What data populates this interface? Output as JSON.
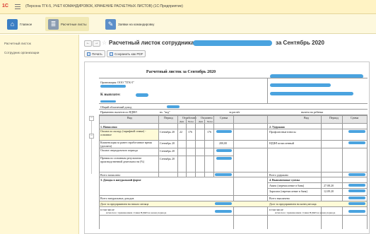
{
  "app": {
    "logo": "1С",
    "title": "(Персона ТГК-5, УЧЕТ КОМАНДИРОВОК, КРАЧЕНИЕ РАСЧЕТНЫХ ЛИСТОВ) (1С:Предприятие)"
  },
  "toolbar": {
    "items": [
      {
        "label": "Главное"
      },
      {
        "label": "Расчетные листы"
      },
      {
        "label": "Заявки на командировку"
      }
    ]
  },
  "sidebar": {
    "items": [
      {
        "label": "Расчетный листок"
      },
      {
        "label": "Сотрудник организации"
      }
    ]
  },
  "header": {
    "title": "Расчетный листок сотрудника",
    "period": "за Сентябрь 2020"
  },
  "actions": {
    "print": "Печать",
    "save_pdf": "Сохранить как PDF"
  },
  "document": {
    "heading": "Расчетный листок за Сентябрь 2020",
    "org_label": "Организация: ООО \"ТГК-5\"",
    "payout_label": "К выплате:",
    "total_worked": "Общий облагаемый доход",
    "tax_rate": "Применено вычетов по НДФЛ",
    "code_label": "вх. \"код\"",
    "period_label": "за расчёт",
    "tax_deduction": "вычета на ребенка",
    "col_type": "Вид",
    "col_period": "Период",
    "col_worked": "Отработано",
    "col_paid": "Оплачено",
    "col_days": "Дни",
    "col_hours": "Часы",
    "col_sum": "Сумма",
    "section1": "1. Начислено",
    "section2": "2. Удержано",
    "section3": "3. Доходы в натуральной форме",
    "section4": "4. Выплаченные суммы",
    "accruals": [
      {
        "name": "Оплата по окладу (тарифной ставке) - основное",
        "period": "Сентябрь 20",
        "days": "22",
        "hours": "176",
        "paid_hours": "176"
      },
      {
        "name": "Компенсация за ранее отработанное время (доплата)",
        "period": "Сентябрь 20",
        "sum": "200,00"
      },
      {
        "name": "Оплата сверхурочного периода",
        "period": "Сентябрь 20"
      },
      {
        "name": "Премия по основным результатам производственной деятельности (%)",
        "period": "Сентябрь 20"
      }
    ],
    "deductions": [
      {
        "name": "Профсоюзные взносы"
      },
      {
        "name": "НДФЛ исчисленный"
      }
    ],
    "total_accrued": "Всего начислено",
    "total_deducted": "Всего удержано",
    "payments": [
      {
        "name": "Аванс (перечисление в банк)",
        "date": "27.08.20"
      },
      {
        "name": "Зарплата (перечисление в банк)",
        "date": "12.09.20"
      }
    ],
    "total_natural": "Всего натуральных доходов",
    "total_paid": "Всего выплачено",
    "due_start": "Долг за предприятием на начало месяца",
    "due_end": "Долг за предприятием на конец месяца",
    "in_total": "в том числе",
    "ndfl_note": "исчислен с применением ставки НДФЛ на конец периода"
  },
  "colors": {
    "titlebar": "#fff3c4",
    "sidebar": "#fff8d6",
    "redaction": "#4aa3df"
  }
}
